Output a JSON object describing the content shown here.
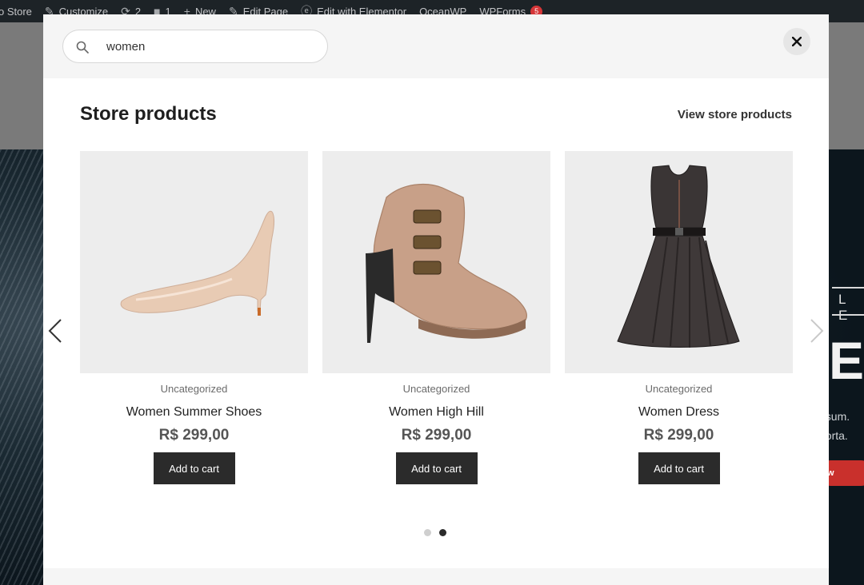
{
  "adminbar": {
    "site_name": "o Store",
    "customize": "Customize",
    "updates": "2",
    "comments": "1",
    "new": "New",
    "edit_page": "Edit Page",
    "elementor": "Edit with Elementor",
    "oceanwp": "OceanWP",
    "wpforms": "WPForms",
    "wpforms_badge": "5"
  },
  "hero": {
    "letters_small": "L E",
    "letter_big": "E",
    "line1": "psum.",
    "line2": "porta.",
    "button": "w"
  },
  "search": {
    "value": "women"
  },
  "modal": {
    "title": "Store products",
    "view_all": "View store products"
  },
  "products": [
    {
      "category": "Uncategorized",
      "name": "Women Summer Shoes",
      "price": "R$ 299,00",
      "button": "Add to cart"
    },
    {
      "category": "Uncategorized",
      "name": "Women High Hill",
      "price": "R$ 299,00",
      "button": "Add to cart"
    },
    {
      "category": "Uncategorized",
      "name": "Women Dress",
      "price": "R$ 299,00",
      "button": "Add to cart"
    }
  ],
  "carousel": {
    "page_count": 2,
    "active_page": 2
  },
  "colors": {
    "button_dark": "#2b2b2b",
    "modal_header": "#f5f5f5",
    "image_bg": "#ededed"
  },
  "icons": [
    "search-icon",
    "close-icon",
    "chevron-left-icon",
    "chevron-right-icon"
  ]
}
